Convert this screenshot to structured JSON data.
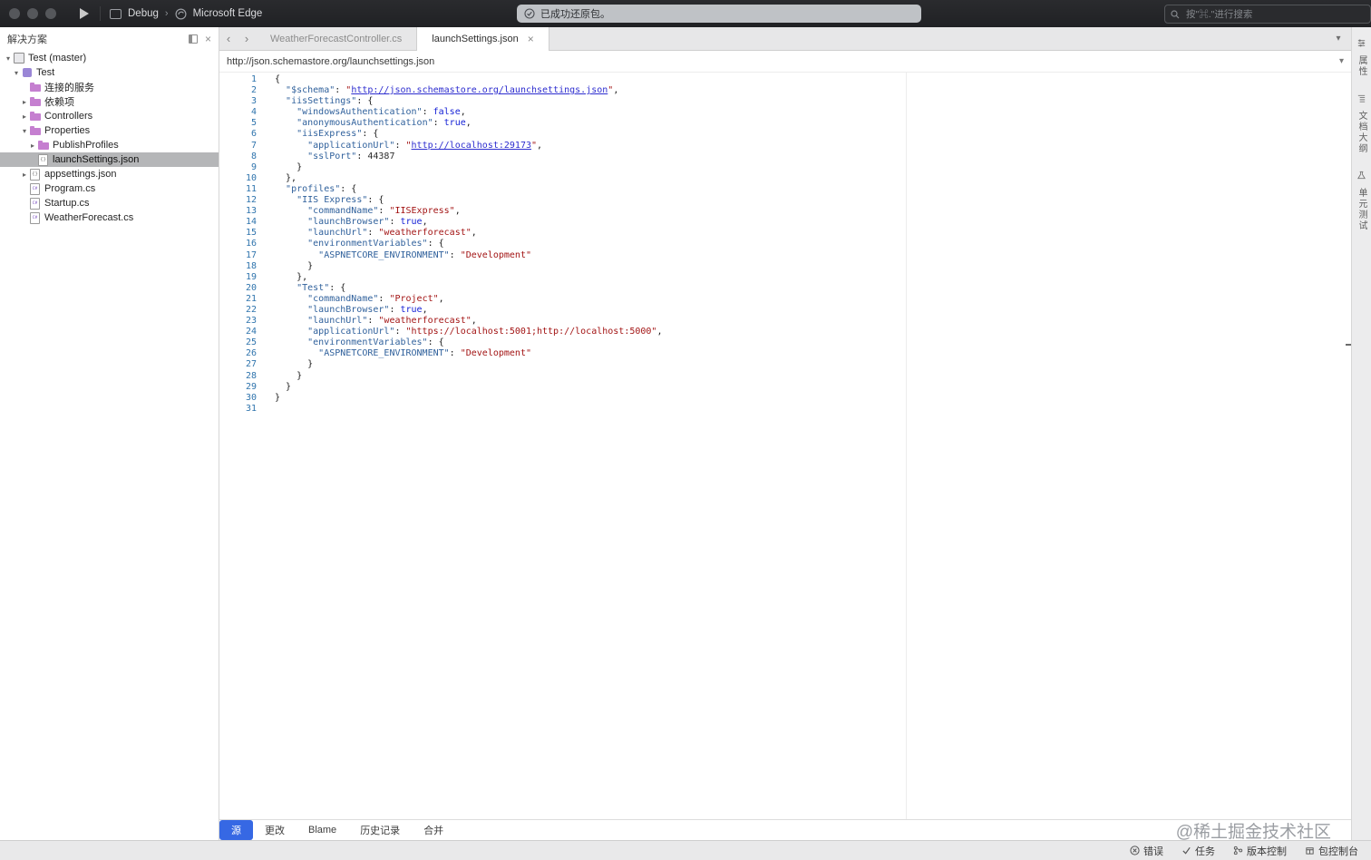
{
  "titlebar": {
    "config_label": "Debug",
    "target_label": "Microsoft Edge",
    "notification": "已成功还原包。",
    "search_placeholder": "按\"⌘.\"进行搜索"
  },
  "sidebar": {
    "title": "解决方案",
    "tree": [
      {
        "label": "Test (master)",
        "level": 0,
        "icon": "solution",
        "expander": "open",
        "selected": false
      },
      {
        "label": "Test",
        "level": 1,
        "icon": "project",
        "expander": "open",
        "selected": false
      },
      {
        "label": "连接的服务",
        "level": 2,
        "icon": "services",
        "expander": "none",
        "selected": false
      },
      {
        "label": "依赖项",
        "level": 2,
        "icon": "folder",
        "expander": "closed",
        "selected": false
      },
      {
        "label": "Controllers",
        "level": 2,
        "icon": "folder",
        "expander": "closed",
        "selected": false
      },
      {
        "label": "Properties",
        "level": 2,
        "icon": "folder",
        "expander": "open",
        "selected": false
      },
      {
        "label": "PublishProfiles",
        "level": 3,
        "icon": "folder",
        "expander": "closed",
        "selected": false
      },
      {
        "label": "launchSettings.json",
        "level": 3,
        "icon": "json",
        "expander": "none",
        "selected": true
      },
      {
        "label": "appsettings.json",
        "level": 2,
        "icon": "json",
        "expander": "closed",
        "selected": false
      },
      {
        "label": "Program.cs",
        "level": 2,
        "icon": "cs",
        "expander": "none",
        "selected": false
      },
      {
        "label": "Startup.cs",
        "level": 2,
        "icon": "cs",
        "expander": "none",
        "selected": false
      },
      {
        "label": "WeatherForecast.cs",
        "level": 2,
        "icon": "cs",
        "expander": "none",
        "selected": false
      }
    ]
  },
  "tabs": {
    "items": [
      {
        "label": "WeatherForecastController.cs",
        "active": false
      },
      {
        "label": "launchSettings.json",
        "active": true
      }
    ]
  },
  "pathbar": {
    "url": "http://json.schemastore.org/launchsettings.json"
  },
  "editor": {
    "lines": [
      [
        [
          "pl",
          "{"
        ]
      ],
      [
        [
          "pl",
          "  "
        ],
        [
          "key",
          "\"$schema\""
        ],
        [
          "pl",
          ": "
        ],
        [
          "str",
          "\""
        ],
        [
          "url",
          "http://json.schemastore.org/launchsettings.json"
        ],
        [
          "str",
          "\""
        ],
        [
          "pl",
          ","
        ]
      ],
      [
        [
          "pl",
          "  "
        ],
        [
          "key",
          "\"iisSettings\""
        ],
        [
          "pl",
          ": {"
        ]
      ],
      [
        [
          "pl",
          "    "
        ],
        [
          "key",
          "\"windowsAuthentication\""
        ],
        [
          "pl",
          ": "
        ],
        [
          "bool",
          "false"
        ],
        [
          "pl",
          ","
        ]
      ],
      [
        [
          "pl",
          "    "
        ],
        [
          "key",
          "\"anonymousAuthentication\""
        ],
        [
          "pl",
          ": "
        ],
        [
          "bool",
          "true"
        ],
        [
          "pl",
          ","
        ]
      ],
      [
        [
          "pl",
          "    "
        ],
        [
          "key",
          "\"iisExpress\""
        ],
        [
          "pl",
          ": {"
        ]
      ],
      [
        [
          "pl",
          "      "
        ],
        [
          "key",
          "\"applicationUrl\""
        ],
        [
          "pl",
          ": "
        ],
        [
          "str",
          "\""
        ],
        [
          "url",
          "http://localhost:29173"
        ],
        [
          "str",
          "\""
        ],
        [
          "pl",
          ","
        ]
      ],
      [
        [
          "pl",
          "      "
        ],
        [
          "key",
          "\"sslPort\""
        ],
        [
          "pl",
          ": "
        ],
        [
          "num",
          "44387"
        ]
      ],
      [
        [
          "pl",
          "    }"
        ]
      ],
      [
        [
          "pl",
          "  },"
        ]
      ],
      [
        [
          "pl",
          "  "
        ],
        [
          "key",
          "\"profiles\""
        ],
        [
          "pl",
          ": {"
        ]
      ],
      [
        [
          "pl",
          "    "
        ],
        [
          "key",
          "\"IIS Express\""
        ],
        [
          "pl",
          ": {"
        ]
      ],
      [
        [
          "pl",
          "      "
        ],
        [
          "key",
          "\"commandName\""
        ],
        [
          "pl",
          ": "
        ],
        [
          "str",
          "\"IISExpress\""
        ],
        [
          "pl",
          ","
        ]
      ],
      [
        [
          "pl",
          "      "
        ],
        [
          "key",
          "\"launchBrowser\""
        ],
        [
          "pl",
          ": "
        ],
        [
          "bool",
          "true"
        ],
        [
          "pl",
          ","
        ]
      ],
      [
        [
          "pl",
          "      "
        ],
        [
          "key",
          "\"launchUrl\""
        ],
        [
          "pl",
          ": "
        ],
        [
          "str",
          "\"weatherforecast\""
        ],
        [
          "pl",
          ","
        ]
      ],
      [
        [
          "pl",
          "      "
        ],
        [
          "key",
          "\"environmentVariables\""
        ],
        [
          "pl",
          ": {"
        ]
      ],
      [
        [
          "pl",
          "        "
        ],
        [
          "key",
          "\"ASPNETCORE_ENVIRONMENT\""
        ],
        [
          "pl",
          ": "
        ],
        [
          "str",
          "\"Development\""
        ]
      ],
      [
        [
          "pl",
          "      }"
        ]
      ],
      [
        [
          "pl",
          "    },"
        ]
      ],
      [
        [
          "pl",
          "    "
        ],
        [
          "key",
          "\"Test\""
        ],
        [
          "pl",
          ": {"
        ]
      ],
      [
        [
          "pl",
          "      "
        ],
        [
          "key",
          "\"commandName\""
        ],
        [
          "pl",
          ": "
        ],
        [
          "str",
          "\"Project\""
        ],
        [
          "pl",
          ","
        ]
      ],
      [
        [
          "pl",
          "      "
        ],
        [
          "key",
          "\"launchBrowser\""
        ],
        [
          "pl",
          ": "
        ],
        [
          "bool",
          "true"
        ],
        [
          "pl",
          ","
        ]
      ],
      [
        [
          "pl",
          "      "
        ],
        [
          "key",
          "\"launchUrl\""
        ],
        [
          "pl",
          ": "
        ],
        [
          "str",
          "\"weatherforecast\""
        ],
        [
          "pl",
          ","
        ]
      ],
      [
        [
          "pl",
          "      "
        ],
        [
          "key",
          "\"applicationUrl\""
        ],
        [
          "pl",
          ": "
        ],
        [
          "str",
          "\"https://localhost:5001;http://localhost:5000\""
        ],
        [
          "pl",
          ","
        ]
      ],
      [
        [
          "pl",
          "      "
        ],
        [
          "key",
          "\"environmentVariables\""
        ],
        [
          "pl",
          ": {"
        ]
      ],
      [
        [
          "pl",
          "        "
        ],
        [
          "key",
          "\"ASPNETCORE_ENVIRONMENT\""
        ],
        [
          "pl",
          ": "
        ],
        [
          "str",
          "\"Development\""
        ]
      ],
      [
        [
          "pl",
          "      }"
        ]
      ],
      [
        [
          "pl",
          "    }"
        ]
      ],
      [
        [
          "pl",
          "  }"
        ]
      ],
      [
        [
          "pl",
          "}"
        ]
      ],
      []
    ]
  },
  "right_dock": {
    "items": [
      {
        "label": "属性",
        "icon": "properties"
      },
      {
        "label": "文档大纲",
        "icon": "outline"
      },
      {
        "label": "单元测试",
        "icon": "tests"
      }
    ]
  },
  "bottom_bar": {
    "tabs": [
      {
        "label": "源",
        "active": true
      },
      {
        "label": "更改",
        "active": false
      },
      {
        "label": "Blame",
        "active": false
      },
      {
        "label": "历史记录",
        "active": false
      },
      {
        "label": "合并",
        "active": false
      }
    ]
  },
  "watermark": {
    "text": "@稀土掘金技术社区"
  },
  "statusbar": {
    "items": [
      {
        "label": "错误",
        "icon": "error"
      },
      {
        "label": "任务",
        "icon": "tasks"
      },
      {
        "label": "版本控制",
        "icon": "vcs"
      },
      {
        "label": "包控制台",
        "icon": "package"
      }
    ]
  },
  "colors": {
    "accent": "#3668e4",
    "selection": "#b5b6b8",
    "key": "#30619c",
    "string": "#a31515",
    "bool": "#1622d6",
    "url": "#2d2dcf"
  }
}
